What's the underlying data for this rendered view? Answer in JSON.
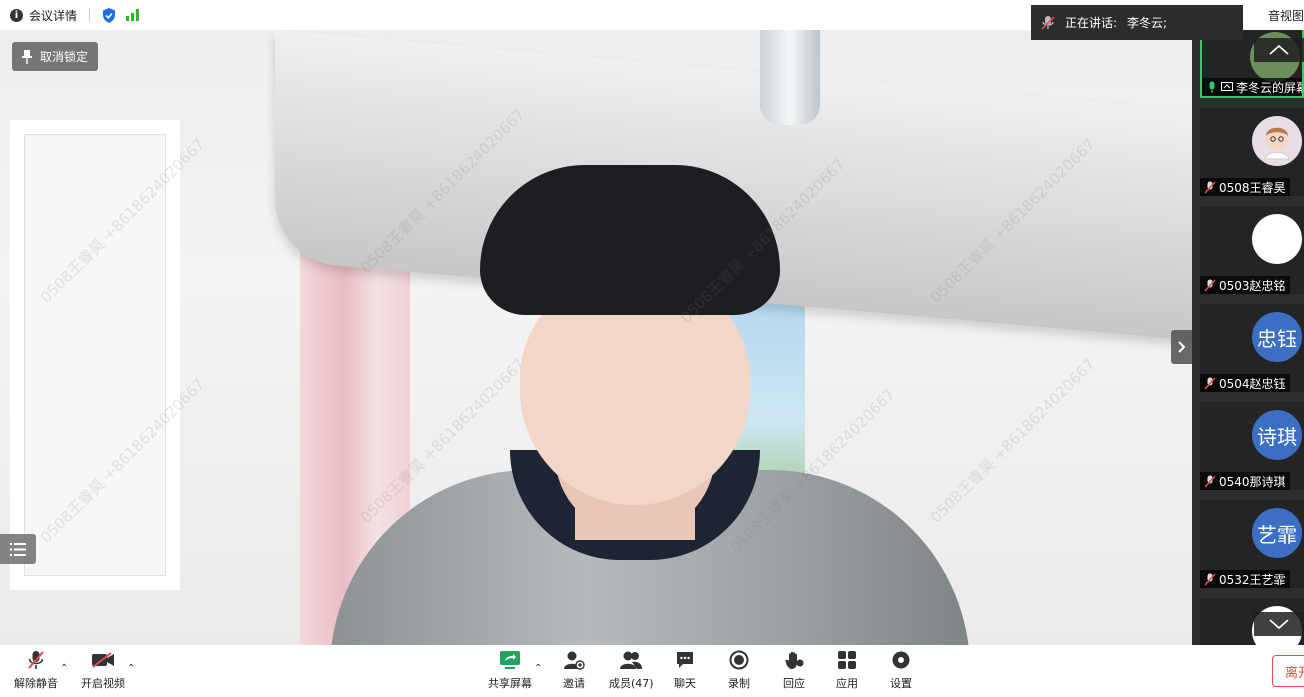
{
  "topbar": {
    "meeting_info_label": "会议详情",
    "gallery_view_label": "音视图"
  },
  "speaking": {
    "label": "正在讲话:",
    "speaker": "李冬云;"
  },
  "main_video": {
    "unlock_label": "取消锁定",
    "watermark_text": "0508王睿昊 +8618624020667"
  },
  "participants": [
    {
      "name": "李冬云的屏幕",
      "avatar_text": "",
      "avatar_color": "#6a8f5a",
      "active": true
    },
    {
      "name": "0508王睿昊",
      "avatar_text": "",
      "avatar_color": "#e8dfe6"
    },
    {
      "name": "0503赵忠铭",
      "avatar_text": "",
      "avatar_color": "#ffffff"
    },
    {
      "name": "0504赵忠钰",
      "avatar_text": "忠钰",
      "avatar_color": "#3c6fc4"
    },
    {
      "name": "0540那诗琪",
      "avatar_text": "诗琪",
      "avatar_color": "#3c6fc4"
    },
    {
      "name": "0532王艺霏",
      "avatar_text": "艺霏",
      "avatar_color": "#3c6fc4"
    }
  ],
  "toolbar": {
    "unmute_label": "解除静音",
    "start_video_label": "开启视频",
    "share_screen_label": "共享屏幕",
    "invite_label": "邀请",
    "members_label": "成员(47)",
    "chat_label": "聊天",
    "record_label": "录制",
    "reactions_label": "回应",
    "apps_label": "应用",
    "settings_label": "设置",
    "leave_label": "离开"
  },
  "colors": {
    "accent_green": "#2ecc71",
    "leave_red": "#e64a4a",
    "avatar_blue": "#3c6fc4"
  }
}
